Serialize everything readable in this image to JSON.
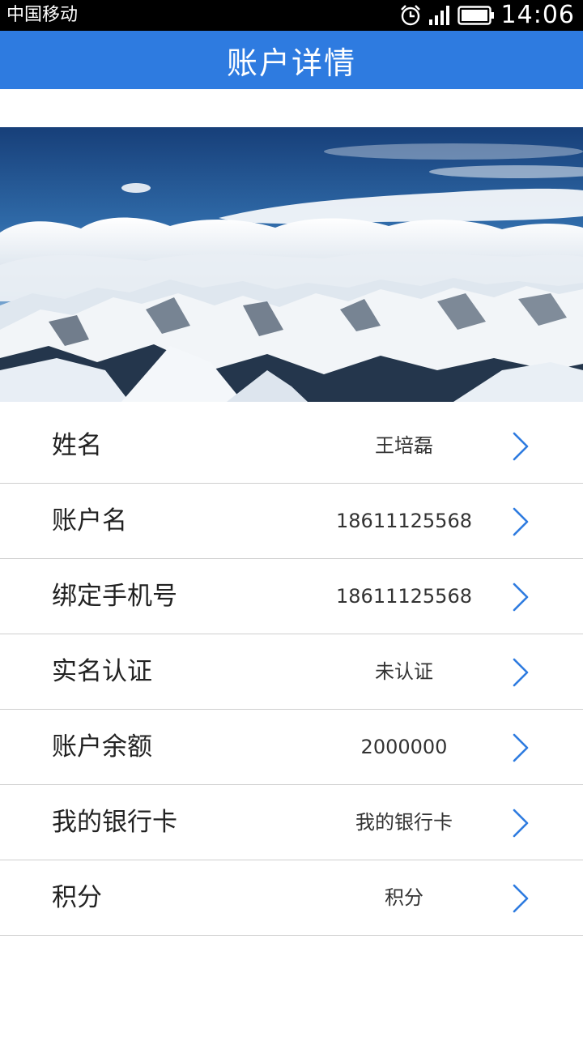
{
  "status_bar": {
    "carrier": "中国移动",
    "time": "14:06",
    "icons": [
      "alarm-icon",
      "signal-icon",
      "battery-icon"
    ]
  },
  "app_bar": {
    "title": "账户详情"
  },
  "banner": {
    "alt": "snowy-mountain-landscape"
  },
  "account_rows": [
    {
      "label": "姓名",
      "value": "王培磊"
    },
    {
      "label": "账户名",
      "value": "18611125568"
    },
    {
      "label": "绑定手机号",
      "value": "18611125568"
    },
    {
      "label": "实名认证",
      "value": "未认证"
    },
    {
      "label": "账户余额",
      "value": "2000000"
    },
    {
      "label": "我的银行卡",
      "value": "我的银行卡"
    },
    {
      "label": "积分",
      "value": "积分"
    }
  ],
  "colors": {
    "app_bar": "#2e7be0",
    "chevron": "#2e7be0",
    "divider": "#cfcfcf"
  }
}
